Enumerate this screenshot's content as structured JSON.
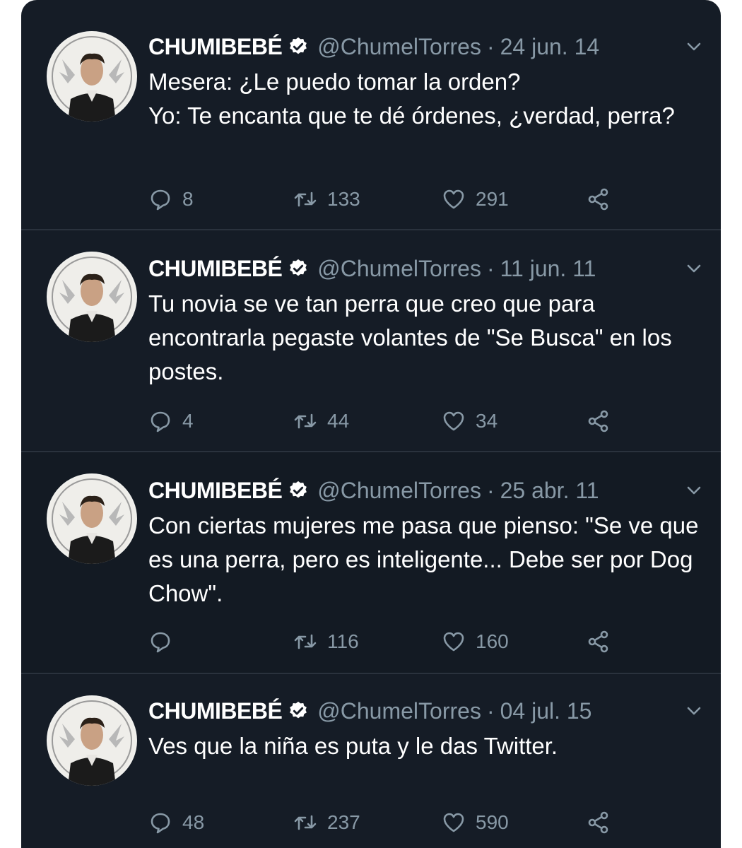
{
  "colors": {
    "background": "#151c26",
    "text": "#ffffff",
    "secondary": "#8899a6",
    "divider": "#2a323d",
    "verified_badge": "#ffffff"
  },
  "icons": {
    "reply": "reply-bubble-icon",
    "retweet": "retweet-icon",
    "like": "heart-icon",
    "share": "share-icon",
    "verified": "verified-badge-icon",
    "menu": "chevron-down-icon"
  },
  "tweets": [
    {
      "name": "CHUMIBEBÉ",
      "handle": "@ChumelTorres",
      "separator": "·",
      "date": "24 jun. 14",
      "text": "Mesera: ¿Le puedo tomar la orden?\nYo: Te encanta que te dé órdenes, ¿verdad, perra?",
      "replies": "8",
      "retweets": "133",
      "likes": "291"
    },
    {
      "name": "CHUMIBEBÉ",
      "handle": "@ChumelTorres",
      "separator": "·",
      "date": "11 jun. 11",
      "text": "Tu novia se ve tan perra que creo que para encontrarla pegaste volantes de \"Se Busca\" en los postes.",
      "replies": "4",
      "retweets": "44",
      "likes": "34"
    },
    {
      "name": "CHUMIBEBÉ",
      "handle": "@ChumelTorres",
      "separator": "·",
      "date": "25 abr. 11",
      "text": "Con ciertas mujeres me pasa que pienso: \"Se ve que es una perra, pero es inteligente... Debe ser por Dog Chow\".",
      "replies": "",
      "retweets": "116",
      "likes": "160"
    },
    {
      "name": "CHUMIBEBÉ",
      "handle": "@ChumelTorres",
      "separator": "·",
      "date": "04 jul. 15",
      "text": "Ves que la niña es puta y le das Twitter.",
      "replies": "48",
      "retweets": "237",
      "likes": "590"
    }
  ]
}
